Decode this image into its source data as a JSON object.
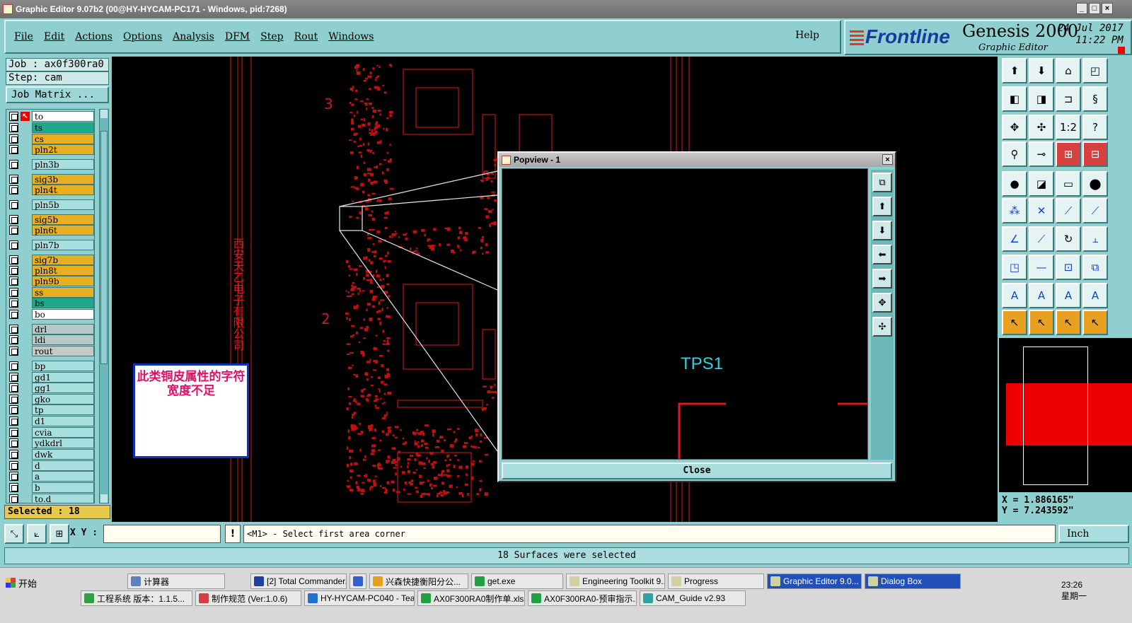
{
  "window": {
    "title": "Graphic Editor 9.07b2 (00@HY-HYCAM-PC171 - Windows, pid:7268)"
  },
  "menu": {
    "items": [
      "File",
      "Edit",
      "Actions",
      "Options",
      "Analysis",
      "DFM",
      "Step",
      "Rout",
      "Windows"
    ],
    "help": "Help"
  },
  "brand": {
    "logo": "Frontline",
    "product": "Genesis 2000",
    "subtitle": "Graphic Editor",
    "date": "24 Jul 2017",
    "time": "11:22 PM"
  },
  "job": {
    "job": "Job : ax0f300ra0",
    "step": "Step: cam",
    "matrix_button": "Job Matrix ..."
  },
  "layers": [
    {
      "name": "to",
      "color": "#ffffff"
    },
    {
      "name": "ts",
      "color": "#1fa88a"
    },
    {
      "name": "cs",
      "color": "#e8b020"
    },
    {
      "name": "pln2t",
      "color": "#e8b020"
    },
    {
      "name": "pln3b",
      "color": "#a8dede"
    },
    {
      "name": "sig3b",
      "color": "#e8b020"
    },
    {
      "name": "pln4t",
      "color": "#e8b020"
    },
    {
      "name": "pln5b",
      "color": "#a8dede"
    },
    {
      "name": "sig5b",
      "color": "#e8b020"
    },
    {
      "name": "pln6t",
      "color": "#e8b020"
    },
    {
      "name": "pln7b",
      "color": "#a8dede"
    },
    {
      "name": "sig7b",
      "color": "#e8b020"
    },
    {
      "name": "pln8t",
      "color": "#e8b020"
    },
    {
      "name": "pln9b",
      "color": "#e8b020"
    },
    {
      "name": "ss",
      "color": "#e8b020"
    },
    {
      "name": "bs",
      "color": "#1fa88a"
    },
    {
      "name": "bo",
      "color": "#ffffff"
    },
    {
      "name": "drl",
      "color": "#b8c8c8"
    },
    {
      "name": "ldi",
      "color": "#b8c8c8"
    },
    {
      "name": "rout",
      "color": "#c8c8c8"
    },
    {
      "name": "bp",
      "color": "#a8dede"
    },
    {
      "name": "gd1",
      "color": "#a8dede"
    },
    {
      "name": "gg1",
      "color": "#a8dede"
    },
    {
      "name": "gko",
      "color": "#a8dede"
    },
    {
      "name": "tp",
      "color": "#a8dede"
    },
    {
      "name": "d1",
      "color": "#a8dede"
    },
    {
      "name": "cvia",
      "color": "#a8dede"
    },
    {
      "name": "ydkdrl",
      "color": "#a8dede"
    },
    {
      "name": "dwk",
      "color": "#a8dede"
    },
    {
      "name": "d",
      "color": "#a8dede"
    },
    {
      "name": "a",
      "color": "#a8dede"
    },
    {
      "name": "b",
      "color": "#a8dede"
    },
    {
      "name": "to.d",
      "color": "#a8dede"
    }
  ],
  "selected": "Selected : 18",
  "canvas": {
    "label3": "3",
    "label2": "2",
    "vertical_text": "西安天乙电子有限公司",
    "note": "此类铜皮属性的字符宽度不足"
  },
  "popview": {
    "title": "Popview - 1",
    "text": "TPS1",
    "close": "Close"
  },
  "coords": {
    "x": "X = 1.886165\"",
    "y": "Y = 7.243592\""
  },
  "bottom": {
    "xy_label": "X Y :",
    "xy_value": "",
    "prompt": "<M1> - Select first area corner",
    "unit": "Inch",
    "excl": "!"
  },
  "status": "18 Surfaces were selected",
  "taskbar": {
    "start": "开始",
    "row1": [
      {
        "label": "计算器",
        "color": "#6080c0"
      },
      {
        "label": "[2] Total Commander...",
        "color": "#2040a0"
      },
      {
        "label": "",
        "color": "#3060d0"
      },
      {
        "label": "兴森快捷衡阳分公...",
        "color": "#e0a020"
      },
      {
        "label": "get.exe",
        "color": "#20a040"
      },
      {
        "label": "Engineering Toolkit 9...",
        "color": "#d0d0a0"
      },
      {
        "label": "Progress",
        "color": "#d0d0a0"
      },
      {
        "label": "Graphic Editor 9.0...",
        "color": "#d0d0a0"
      },
      {
        "label": "Dialog Box",
        "color": "#d0d0a0"
      }
    ],
    "row2": [
      {
        "label": "工程系统 版本：1.1.5...",
        "color": "#30a040"
      },
      {
        "label": "制作规范 (Ver:1.0.6)",
        "color": "#d04040"
      },
      {
        "label": "HY-HYCAM-PC040 - Tea...",
        "color": "#2070d0"
      },
      {
        "label": "AX0F300RA0制作单.xls ...",
        "color": "#20a040"
      },
      {
        "label": "AX0F300RA0-预审指示....",
        "color": "#20a040"
      },
      {
        "label": "CAM_Guide v2.93",
        "color": "#30a0a0"
      }
    ],
    "clock": "23:26",
    "weekday": "星期一"
  }
}
